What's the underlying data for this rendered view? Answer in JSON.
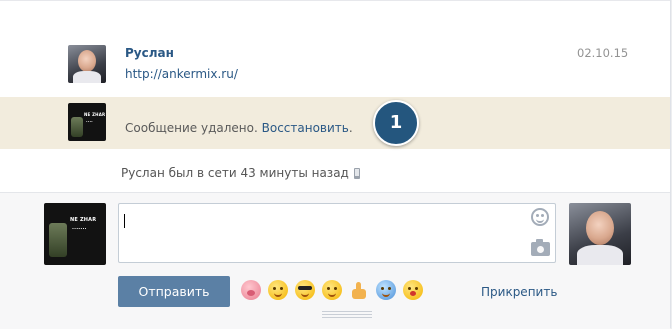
{
  "message": {
    "author": "Руслан",
    "text_link": "http://ankermix.ru/",
    "date": "02.10.15"
  },
  "deleted": {
    "notice": "Сообщение удалено. ",
    "restore_label": "Восстановить",
    "period": "."
  },
  "badge": {
    "number": "1"
  },
  "status": {
    "online_text": "Руслан был в сети 43 минуты назад"
  },
  "composer": {
    "message_value": "",
    "send_label": "Отправить",
    "attach_label": "Прикрепить",
    "emojis": [
      "pig-face",
      "smiling-face",
      "sunglasses-face",
      "rolling-eyes-face",
      "thumbs-up",
      "anxious-sweat-face",
      "tongue-face"
    ]
  },
  "colors": {
    "link": "#2a5885",
    "deleted_bg": "#f2ecdd",
    "badge": "#24567e",
    "send_button": "#5b80a5"
  }
}
